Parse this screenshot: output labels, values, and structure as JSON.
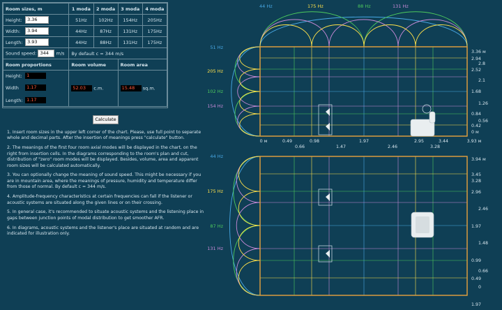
{
  "room_sizes": {
    "header": "Room sizes, m",
    "mode_headers": [
      "1 moda",
      "2 moda",
      "3 moda",
      "4 moda"
    ],
    "rows": [
      {
        "label": "Height:",
        "value": "3.36",
        "modes": [
          "51Hz",
          "102Hz",
          "154Hz",
          "205Hz"
        ]
      },
      {
        "label": "Width:",
        "value": "3.94",
        "modes": [
          "44Hz",
          "87Hz",
          "131Hz",
          "175Hz"
        ]
      },
      {
        "label": "Length:",
        "value": "3.93",
        "modes": [
          "44Hz",
          "88Hz",
          "131Hz",
          "175Hz"
        ]
      }
    ],
    "sound_speed_label": "Sound speed:",
    "sound_speed_value": "344",
    "sound_speed_unit": "m/s",
    "sound_speed_default": "By default c = 344 m/s"
  },
  "proportions": {
    "header": "Room proportions",
    "height_label": "Height:",
    "height_value": "1",
    "width_label": "Width",
    "width_value": "1.17",
    "length_label": "Length:",
    "length_value": "1.17",
    "volume_header": "Room volume",
    "volume_value": "52.03",
    "volume_unit": "c.m.",
    "area_header": "Room area",
    "area_value": "15.48",
    "area_unit": "sq.m."
  },
  "calculate_label": "Calculate",
  "instructions": [
    "1. Insert room sizes in the upper left corner of the chart. Please, use full point to separate whole and decimal parts. After the insertion of meanings press \"calculate\" button.",
    "2. The meanings of the first four room axial modes will be displayed in the chart, on the right from insertion cells. In the diagrams corresponding to the room's plan and cut, distribution of \"zero\" room modes will be displayed. Besides, volume, area and apparent room sizes will be calculated automatically.",
    "3. You can optionally change the meaning of sound speed. This might be necessary if you are in mountain area, where the meanings of pressure, humidity and temperature differ from those of normal. By default c = 344 m/s.",
    "4. Amplitude-frequency characteristics at certain frequencies can fall if the listener or acoustic systems are situated along the given lines or on their crossing.",
    "5. In general case, it's recommended to situate acoustic systems and the listening place in gaps between junction points of modal distribution to get smoother AFR.",
    "6. In diagrams, acoustic systems and the listener's place are situated at random and are indicated for illustration only."
  ],
  "top_diagram": {
    "top_freq_labels": [
      "44 Hz",
      "175 Hz",
      "88 Hz",
      "131 Hz"
    ],
    "left_freq_labels": [
      "51 Hz",
      "205 Hz",
      "102 Hz",
      "154 Hz"
    ],
    "right_ticks": [
      "3.36 м",
      "2.94",
      "2.8",
      "2.52",
      "2.1",
      "1.68",
      "1.26",
      "0.84",
      "0.56",
      "0.42",
      "0 м"
    ],
    "bottom_ticks_row1": [
      "0 м",
      "0.49",
      "0.98",
      "1.97",
      "2.95",
      "3.44",
      "3.93 м"
    ],
    "bottom_ticks_row2": [
      "0.66",
      "1.47",
      "2.46",
      "3.28"
    ]
  },
  "bottom_diagram": {
    "left_freq_labels": [
      "44 Hz",
      "175 Hz",
      "87 Hz",
      "131 Hz"
    ],
    "right_ticks": [
      "3.94 м",
      "3.45",
      "3.28",
      "2.96",
      "2.46",
      "1.97",
      "1.48",
      "0.99",
      "0.66",
      "0.49",
      "0",
      "1.97"
    ]
  },
  "colors": {
    "background": "#0f3f55",
    "frame": "#e8a23c",
    "mode1": "#48a9e6",
    "mode2": "#4ecb5d",
    "mode3": "#c98ad8",
    "mode4": "#ffe14a"
  }
}
